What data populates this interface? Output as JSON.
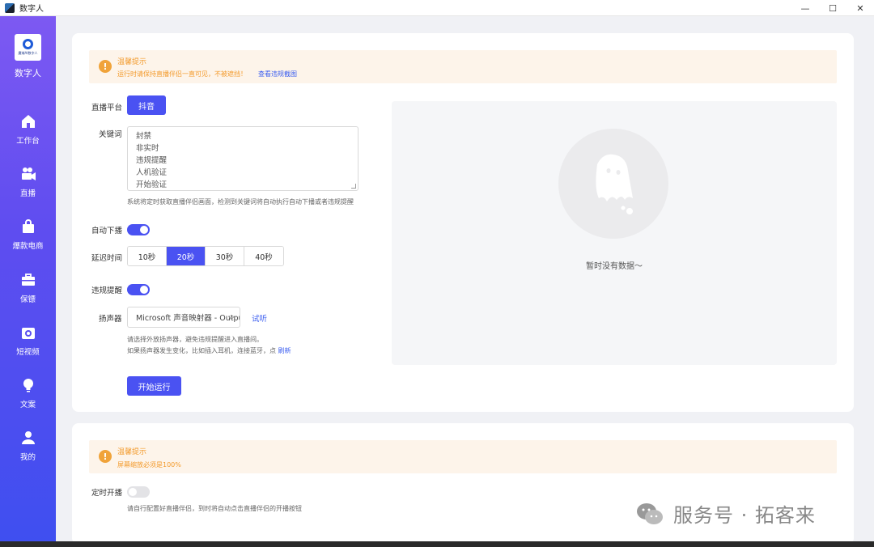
{
  "window": {
    "title": "数字人",
    "controls": [
      "—",
      "☐",
      "✕"
    ]
  },
  "sidebar": {
    "logo_text": "魔域AI数字人",
    "brand": "数字人",
    "items": [
      {
        "label": "工作台",
        "icon": "home-icon"
      },
      {
        "label": "直播",
        "icon": "video-camera-icon"
      },
      {
        "label": "爆款电商",
        "icon": "shopping-bag-icon"
      },
      {
        "label": "保镖",
        "icon": "briefcase-icon"
      },
      {
        "label": "短视频",
        "icon": "camera-icon"
      },
      {
        "label": "文案",
        "icon": "lightbulb-icon"
      },
      {
        "label": "我的",
        "icon": "user-icon"
      }
    ]
  },
  "notice1": {
    "title": "温馨提示",
    "text": "运行时请保持直播伴侣一直可见，不被遮挡！",
    "link": "查看违规截图"
  },
  "platform": {
    "label": "直播平台",
    "value": "抖音"
  },
  "keywords": {
    "label": "关键词",
    "lines": [
      "封禁",
      "非实时",
      "违规提醒",
      "人机验证",
      "开始验证"
    ],
    "hint": "系统将定时获取直播伴侣画面，检测到关键词将自动执行自动下播或者违规提醒"
  },
  "auto_off": {
    "label": "自动下播",
    "on": true
  },
  "delay": {
    "label": "延迟时间",
    "options": [
      "10秒",
      "20秒",
      "30秒",
      "40秒"
    ],
    "selected": "20秒"
  },
  "violation": {
    "label": "违规提醒",
    "on": true
  },
  "speaker": {
    "label": "扬声器",
    "value": "Microsoft 声音映射器 - Output",
    "test_link": "试听",
    "hint1": "请选择外放扬声器，避免违规提醒进入直播间。",
    "hint2": "如果扬声器发生变化，比如插入耳机，连接蓝牙，点",
    "refresh_link": "刷新"
  },
  "start_button": "开始运行",
  "empty_state": {
    "text": "暂时没有数据～",
    "icon": "ghost-icon"
  },
  "notice2": {
    "title": "温馨提示",
    "text": "屏幕缩放必须是100%"
  },
  "scheduled": {
    "label": "定时开播",
    "on": false,
    "hint": "请自行配置好直播伴侣，到时将自动点击直播伴侣的开播按钮"
  },
  "watermark": {
    "text": "服务号 · 拓客来",
    "icon": "wechat-icon"
  },
  "colors": {
    "accent": "#4a52f2",
    "warning": "#f39a2b",
    "sidebar_top": "#7d59f2",
    "sidebar_bottom": "#3f4ff0"
  }
}
